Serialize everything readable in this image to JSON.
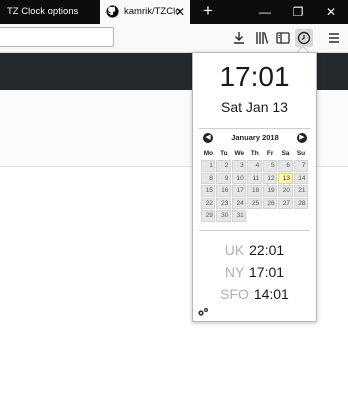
{
  "tabs": {
    "inactive_title": "TZ Clock options",
    "active_title": "kamrik/TZClo",
    "close_label": "✕",
    "new_tab_label": "+"
  },
  "window_controls": {
    "minimize": "—",
    "restore": "❐",
    "close": "✕"
  },
  "toolbar": {
    "icons": [
      "download-icon",
      "library-icon",
      "sidebar-icon",
      "clock-icon",
      "menu-icon"
    ]
  },
  "popup": {
    "time": "17:01",
    "date": "Sat Jan 13",
    "calendar": {
      "title": "January 2018",
      "prev_label": "◀",
      "next_label": "▶",
      "days_of_week": [
        "Mo",
        "Tu",
        "We",
        "Th",
        "Fr",
        "Sa",
        "Su"
      ],
      "weeks": [
        [
          "",
          "",
          "",
          "",
          "",
          "",
          ""
        ],
        [
          "1",
          "2",
          "3",
          "4",
          "5",
          "6",
          "7"
        ],
        [
          "8",
          "9",
          "10",
          "11",
          "12",
          "13",
          "14"
        ],
        [
          "15",
          "16",
          "17",
          "18",
          "19",
          "20",
          "21"
        ],
        [
          "22",
          "23",
          "24",
          "25",
          "26",
          "27",
          "28"
        ],
        [
          "29",
          "30",
          "31",
          "",
          "",
          "",
          ""
        ]
      ],
      "today": "13"
    },
    "zones": [
      {
        "abbr": "UK",
        "time": "22:01"
      },
      {
        "abbr": "NY",
        "time": "17:01"
      },
      {
        "abbr": "SFO",
        "time": "14:01"
      }
    ],
    "settings_icon": "gears-icon"
  },
  "colors": {
    "tab_bar": "#0c0c0d",
    "toolbar": "#f9f9fa",
    "page_nav": "#24292e",
    "today_highlight": "#fff7b0"
  }
}
